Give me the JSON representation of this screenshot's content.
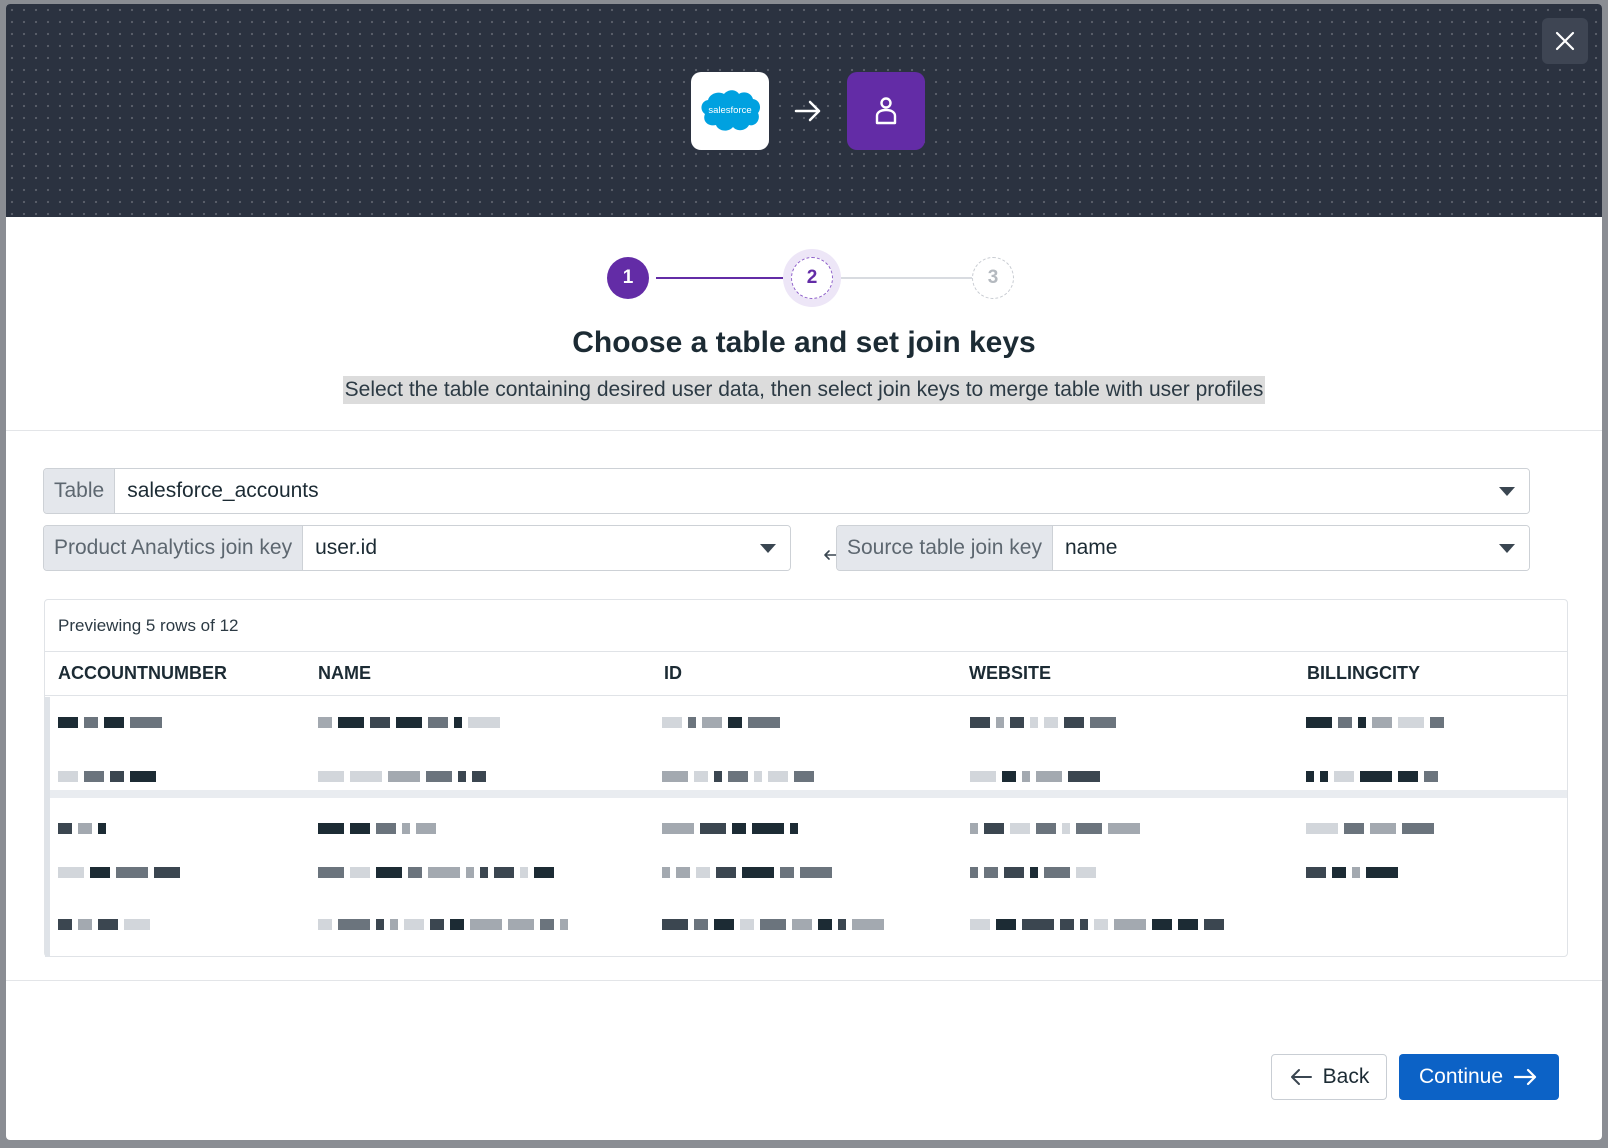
{
  "hero": {
    "source_logo_text": "salesforce",
    "source_name": "Salesforce",
    "target_name": "User profiles"
  },
  "stepper": {
    "steps": [
      "1",
      "2",
      "3"
    ],
    "current": 2
  },
  "title": "Choose a table and set join keys",
  "subtitle": "Select the table containing desired user data, then select join keys to merge table with user profiles",
  "table_select": {
    "label": "Table",
    "value": "salesforce_accounts"
  },
  "join": {
    "product_label": "Product Analytics join key",
    "product_value": "user.id",
    "source_label": "Source table join key",
    "source_value": "name"
  },
  "preview": {
    "caption": "Previewing 5 rows of 12",
    "columns": [
      "ACCOUNTNUMBER",
      "NAME",
      "ID",
      "WEBSITE",
      "BILLINGCITY"
    ],
    "rows_shown": 5,
    "rows_total": 12
  },
  "buttons": {
    "back": "Back",
    "continue": "Continue"
  },
  "colors": {
    "accent_purple": "#632ca6",
    "primary_blue": "#0c62c6",
    "salesforce_blue": "#00a1e0",
    "hero_bg": "#2b3240"
  }
}
